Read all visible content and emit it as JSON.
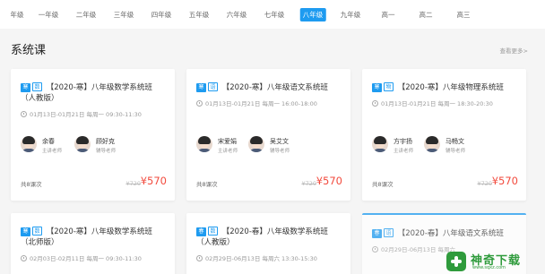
{
  "grades": [
    "年级",
    "一年级",
    "二年级",
    "三年级",
    "四年级",
    "五年级",
    "六年级",
    "七年级",
    "八年级",
    "九年级",
    "高一",
    "高二",
    "高三"
  ],
  "active_grade": "八年级",
  "section": {
    "title": "系统课",
    "more": "查看更多>"
  },
  "accent": "#1e9bf0",
  "price_color": "#f24a3d",
  "cards": [
    {
      "season": "寒",
      "subject": "数",
      "title": "【2020-寒】八年级数学系统班（人教版）",
      "time": "01月13日-01月21日   每周一 09:30-11:30",
      "teachers": [
        {
          "name": "余春",
          "role": "主讲老师"
        },
        {
          "name": "顾好克",
          "role": "辅导老师"
        }
      ],
      "lessons": "共8课次",
      "original_price": "¥720",
      "price": "¥570"
    },
    {
      "season": "寒",
      "subject": "语",
      "title": "【2020-寒】八年级语文系统班",
      "time": "01月13日-01月21日   每周一 16:00-18:00",
      "teachers": [
        {
          "name": "宋爱娟",
          "role": "主讲老师"
        },
        {
          "name": "吴艾文",
          "role": "辅导老师"
        }
      ],
      "lessons": "共8课次",
      "original_price": "¥720",
      "price": "¥570"
    },
    {
      "season": "寒",
      "subject": "物",
      "title": "【2020-寒】八年级物理系统班",
      "time": "01月13日-01月21日   每周一 18:30-20:30",
      "teachers": [
        {
          "name": "方宇扬",
          "role": "主讲老师"
        },
        {
          "name": "马畅文",
          "role": "辅导老师"
        }
      ],
      "lessons": "共8课次",
      "original_price": "¥720",
      "price": "¥570"
    },
    {
      "season": "寒",
      "subject": "数",
      "title": "【2020-寒】八年级数学系统班（北师版）",
      "time": "02月03日-02月11日   每周一 09:30-11:30"
    },
    {
      "season": "春",
      "subject": "数",
      "title": "【2020-春】八年级数学系统班（人教版）",
      "time": "02月29日-06月13日   每周六 13:30-15:30"
    },
    {
      "season": "春",
      "subject": "语",
      "title": "【2020-春】八年级语文系统班",
      "time": "02月29日-06月13日   每周六"
    }
  ],
  "watermark": {
    "text": "神奇下载",
    "url": "www.sqxz.com"
  }
}
